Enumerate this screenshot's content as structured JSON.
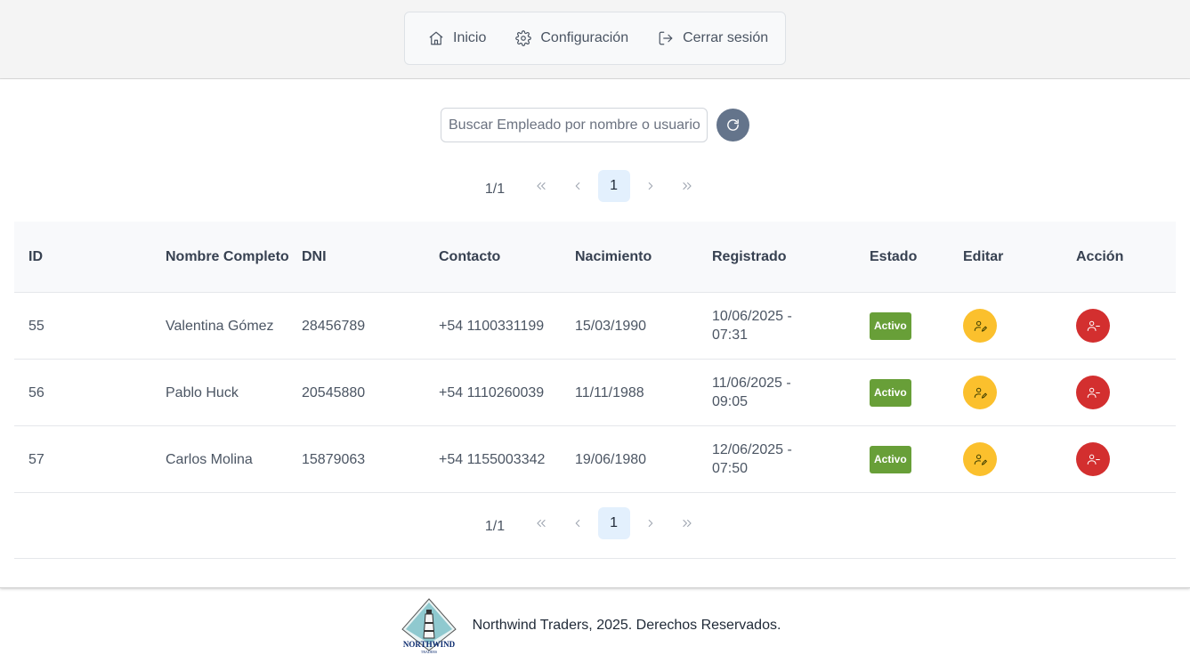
{
  "nav": {
    "items": [
      {
        "label": "Inicio",
        "icon": "home-icon"
      },
      {
        "label": "Configuración",
        "icon": "gear-icon"
      },
      {
        "label": "Cerrar sesión",
        "icon": "sign-out-icon"
      }
    ]
  },
  "search": {
    "placeholder": "Buscar Empleado por nombre o usuario",
    "value": ""
  },
  "pagination": {
    "report": "1/1",
    "current_page": "1"
  },
  "table": {
    "headers": {
      "id": "ID",
      "name": "Nombre Completo",
      "dni": "DNI",
      "contact": "Contacto",
      "birth": "Nacimiento",
      "registered": "Registrado",
      "state": "Estado",
      "edit": "Editar",
      "action": "Acción"
    },
    "rows": [
      {
        "id": "55",
        "name": "Valentina Gómez",
        "dni": "28456789",
        "contact": "+54 1100331199",
        "birth": "15/03/1990",
        "registered": "10/06/2025 - 07:31",
        "state": "Activo"
      },
      {
        "id": "56",
        "name": "Pablo Huck",
        "dni": "20545880",
        "contact": "+54 1110260039",
        "birth": "11/11/1988",
        "registered": "11/06/2025 - 09:05",
        "state": "Activo"
      },
      {
        "id": "57",
        "name": "Carlos Molina",
        "dni": "15879063",
        "contact": "+54 1155003342",
        "birth": "19/06/1980",
        "registered": "12/06/2025 - 07:50",
        "state": "Activo"
      }
    ]
  },
  "footer": {
    "text": "Northwind Traders, 2025. Derechos Reservados.",
    "logo_text": "NORTHWIND",
    "logo_subtext": "TRADERS"
  },
  "colors": {
    "active_badge": "#689f38",
    "edit_button": "#fbc02d",
    "remove_button": "#d32f2f",
    "refresh_button": "#64748b",
    "current_page_bg": "#e3f0fd"
  }
}
